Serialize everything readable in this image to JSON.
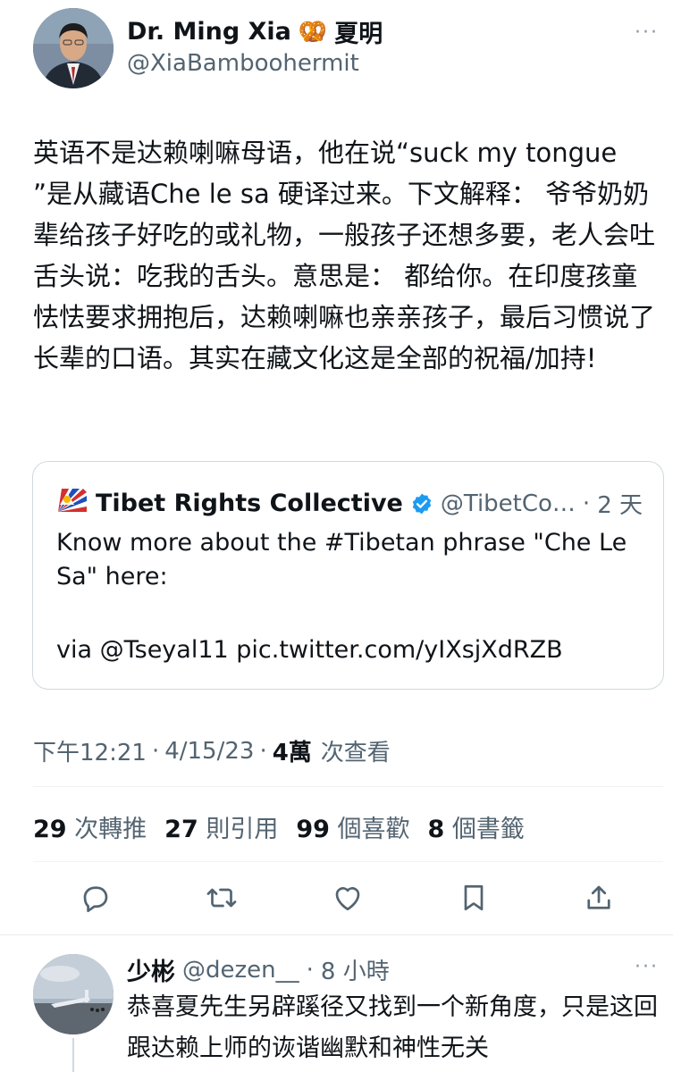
{
  "tweet": {
    "author_name": "Dr. Ming Xia",
    "author_emoji": "🥨",
    "author_name_cn": "夏明",
    "author_handle": "@XiaBamboohermit",
    "more_label": "···",
    "text": "英语不是达赖喇嘛母语，他在说“suck my tongue ”是从藏语Che le sa  硬译过来。下文解释： 爷爷奶奶辈给孩子好吃的或礼物，一般孩子还想多要，老人会吐舌头说：吃我的舌头。意思是： 都给你。在印度孩童怯怯要求拥抱后，达赖喇嘛也亲亲孩子，最后习惯说了长辈的口语。其实在藏文化这是全部的祝福/加持!",
    "quote": {
      "author_name": "Tibet Rights Collective",
      "author_handle": "@TibetCo…",
      "separator": "·",
      "time": "2 天",
      "line1": "Know more about the #Tibetan phrase \"Che Le Sa\" here:",
      "line2": "via @Tseyal11 pic.twitter.com/yIXsjXdRZB"
    },
    "meta": {
      "time": "下午12:21",
      "dot1": "·",
      "date": "4/15/23",
      "dot2": "·",
      "views_count": "4萬",
      "views_label": "次查看"
    },
    "stats": [
      {
        "count": "29",
        "label": "次轉推"
      },
      {
        "count": "27",
        "label": "則引用"
      },
      {
        "count": "99",
        "label": "個喜歡"
      },
      {
        "count": "8",
        "label": "個書籤"
      }
    ],
    "actions": [
      "reply-icon",
      "retweet-icon",
      "like-icon",
      "bookmark-icon",
      "share-icon"
    ]
  },
  "reply": {
    "author_name": "少彬",
    "author_handle": "@dezen__",
    "separator": "·",
    "time": "8 小時",
    "more_label": "···",
    "text": "恭喜夏先生另辟蹊径又找到一个新角度，只是这回跟达赖上师的诙谐幽默和神性无关"
  },
  "colors": {
    "text": "#0f1419",
    "muted": "#536471",
    "border": "#cfd9de",
    "verified": "#1d9bf0"
  }
}
